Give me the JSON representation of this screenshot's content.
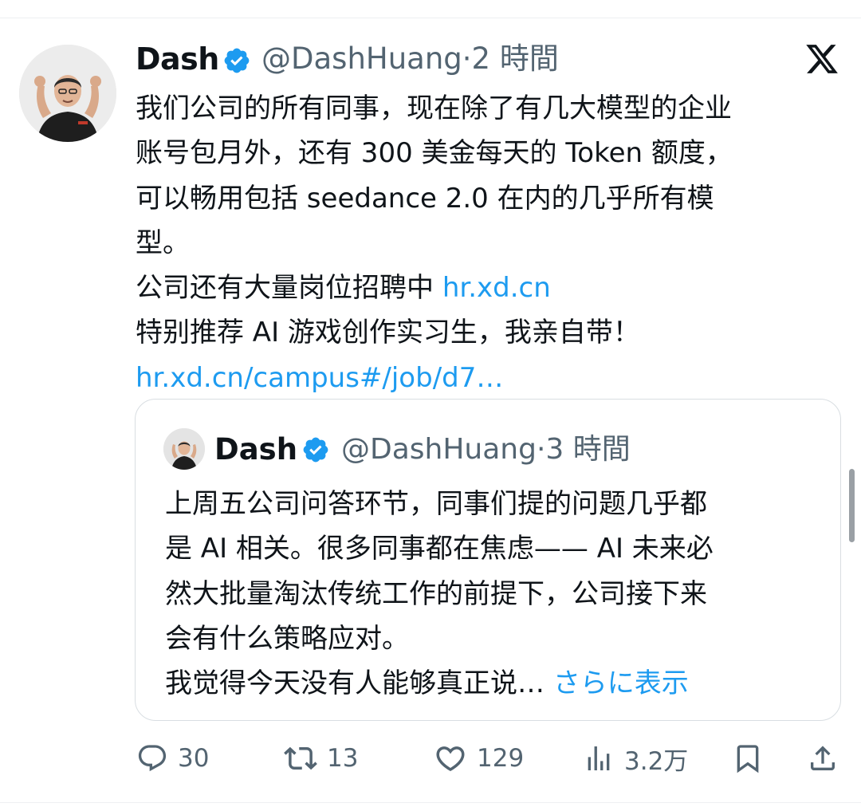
{
  "tweet": {
    "author_name": "Dash",
    "handle": "@DashHuang",
    "separator": "·",
    "time": "2 時間",
    "body_lines": [
      "我们公司的所有同事，现在除了有几大模型的企业",
      "账号包月外，还有 300 美金每天的 Token 额度，",
      "可以畅用包括 seedance 2.0 在内的几乎所有模",
      "型。"
    ],
    "hiring_text": "公司还有大量岗位招聘中 ",
    "hiring_link": "hr.xd.cn",
    "recommend_text": "特别推荐 AI 游戏创作实习生，我亲自带！",
    "campus_link": "hr.xd.cn/campus#/job/d7…"
  },
  "quote": {
    "author_name": "Dash",
    "handle": "@DashHuang",
    "separator": "·",
    "time": "3 時間",
    "body_lines": [
      "上周五公司问答环节，同事们提的问题几乎都",
      "是 AI 相关。很多同事都在焦虑—— AI 未来必",
      "然大批量淘汰传统工作的前提下，公司接下来",
      "会有什么策略应对。"
    ],
    "last_line": "我觉得今天没有人能够真正说… ",
    "show_more": "さらに表示"
  },
  "actions": {
    "replies": "30",
    "retweets": "13",
    "likes": "129",
    "views": "3.2万"
  },
  "colors": {
    "link": "#1d9bf0",
    "verified": "#1d9bf0",
    "secondary_text": "#536471",
    "primary_text": "#0f1419"
  }
}
